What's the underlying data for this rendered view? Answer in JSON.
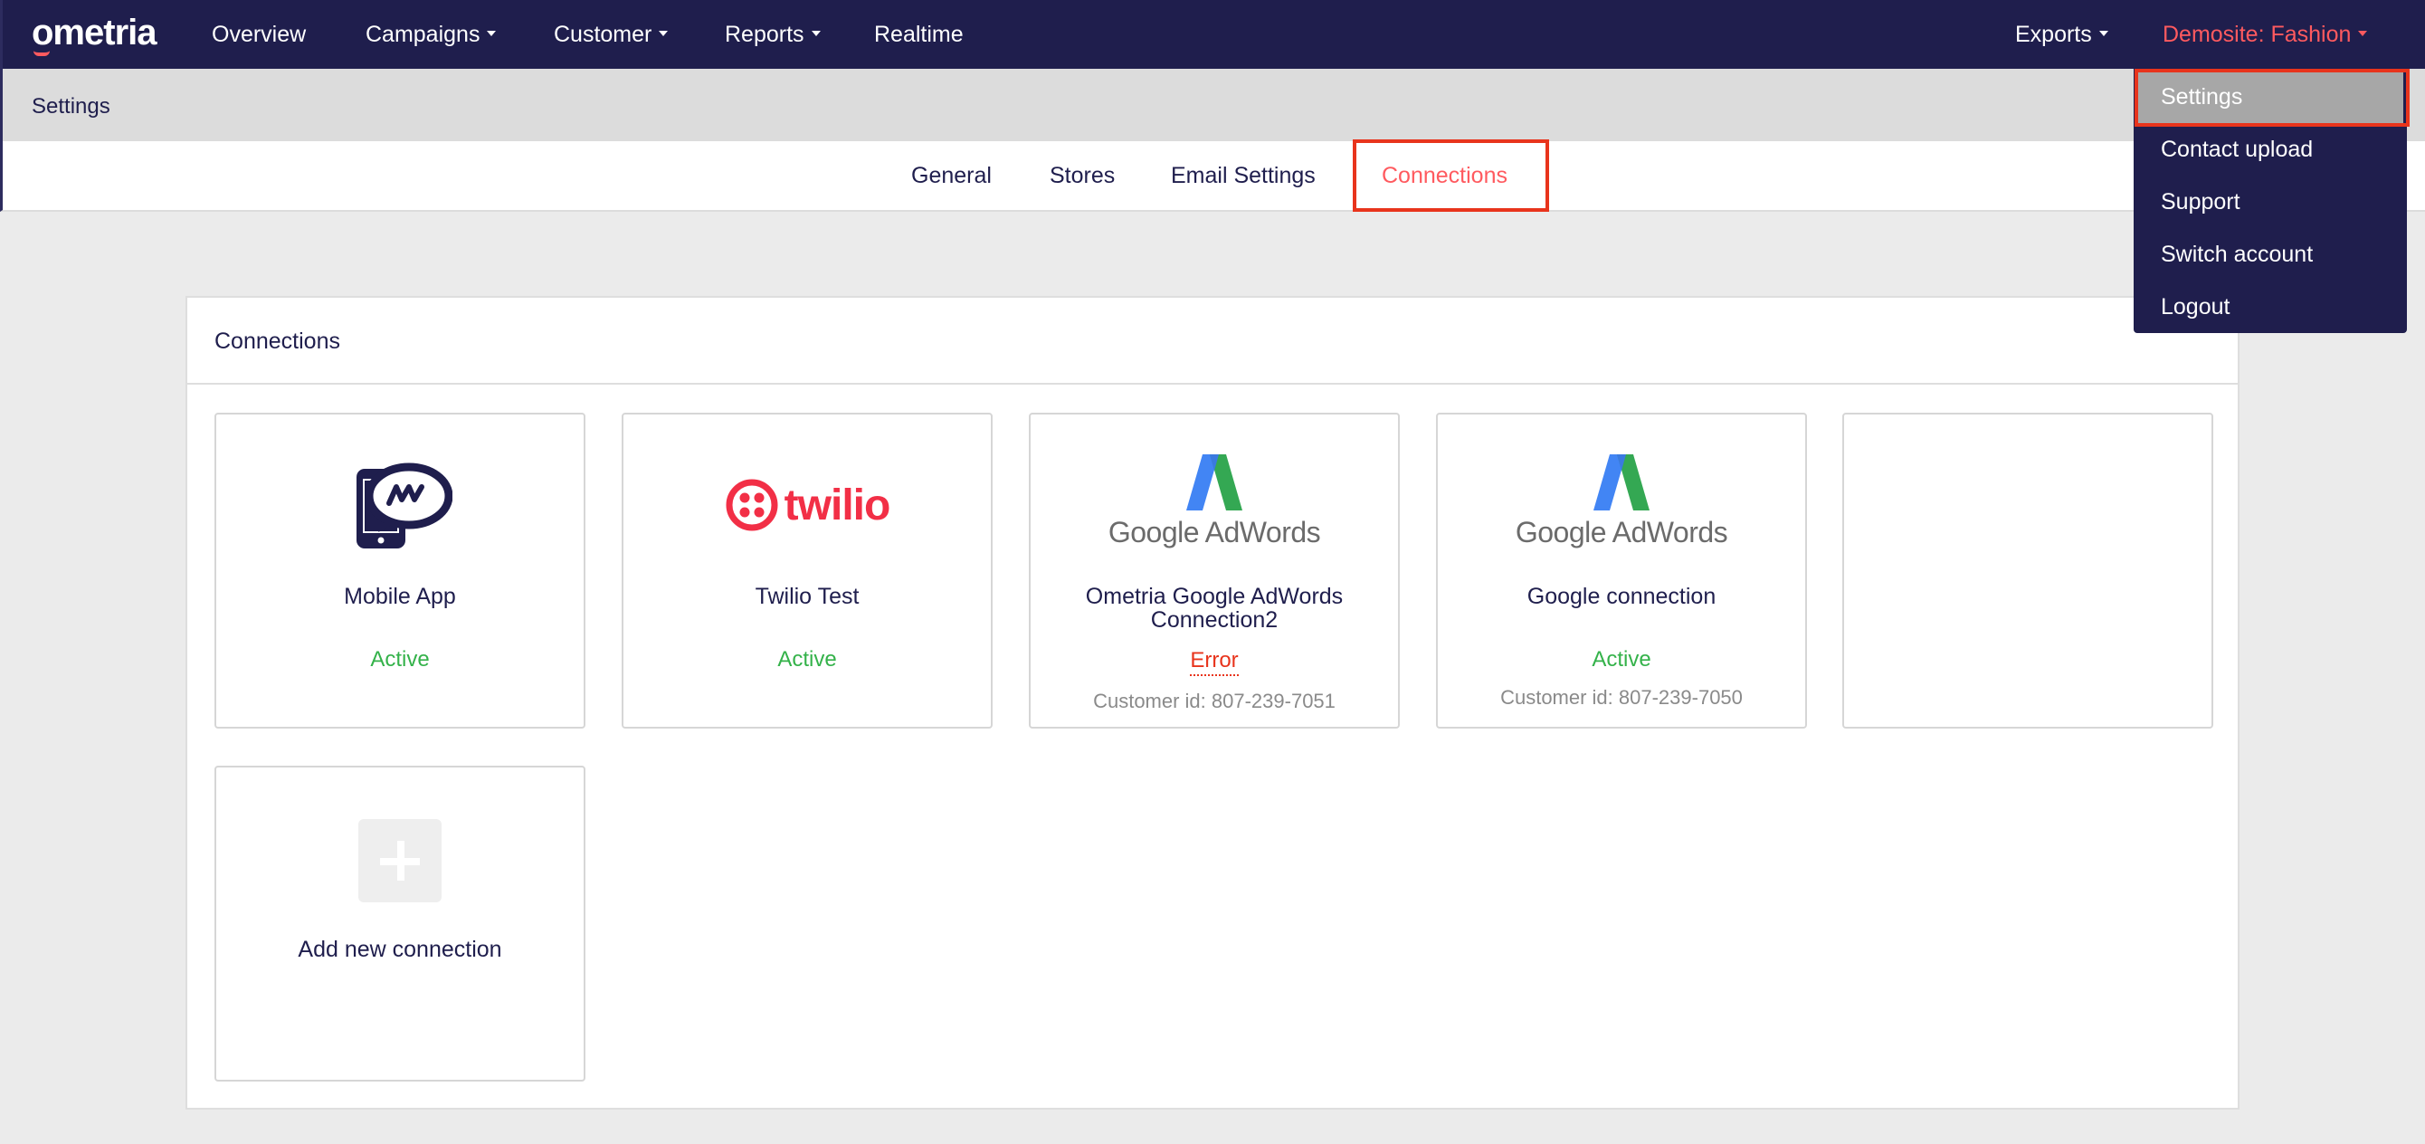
{
  "brand": {
    "name": "ometria",
    "accent": "#ff5a5f",
    "nav_bg": "#1f1e4d"
  },
  "nav": {
    "items": [
      {
        "label": "Overview",
        "has_caret": false
      },
      {
        "label": "Campaigns",
        "has_caret": true
      },
      {
        "label": "Customer",
        "has_caret": true
      },
      {
        "label": "Reports",
        "has_caret": true
      },
      {
        "label": "Realtime",
        "has_caret": false
      }
    ],
    "exports_label": "Exports",
    "account_label": "Demosite: Fashion"
  },
  "subheader": {
    "title": "Settings"
  },
  "tabs": [
    {
      "label": "General",
      "active": false
    },
    {
      "label": "Stores",
      "active": false
    },
    {
      "label": "Email Settings",
      "active": false
    },
    {
      "label": "Connections",
      "active": true
    }
  ],
  "panel": {
    "title": "Connections",
    "cards": [
      {
        "name": "Mobile App",
        "status": "Active",
        "status_type": "active",
        "icon": "mobile-app-icon"
      },
      {
        "name": "Twilio Test",
        "status": "Active",
        "status_type": "active",
        "icon": "twilio-logo",
        "logo_text": "twilio"
      },
      {
        "name": "Ometria Google AdWords Connection2",
        "status": "Error",
        "status_type": "error",
        "customer_id": "Customer id: 807-239-7051",
        "icon": "google-adwords-logo",
        "logo_text": "Google AdWords"
      },
      {
        "name": "Google connection",
        "status": "Active",
        "status_type": "active",
        "customer_id": "Customer id: 807-239-7050",
        "icon": "google-adwords-logo",
        "logo_text": "Google AdWords"
      },
      {
        "name": "",
        "status": "",
        "status_type": "empty"
      }
    ],
    "add_card": {
      "label": "Add new connection",
      "icon": "plus-icon"
    }
  },
  "dropdown": {
    "items": [
      {
        "label": "Settings",
        "selected": true
      },
      {
        "label": "Contact upload",
        "selected": false
      },
      {
        "label": "Support",
        "selected": false
      },
      {
        "label": "Switch account",
        "selected": false
      },
      {
        "label": "Logout",
        "selected": false
      }
    ]
  }
}
